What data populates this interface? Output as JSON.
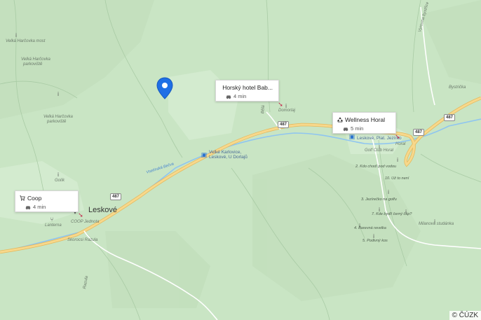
{
  "map": {
    "colors": {
      "land": "#c9e5c4",
      "road": "#f7d88c",
      "road_casing": "#e5b85a",
      "water": "#8fc5f0",
      "pin": "#1f6fe5"
    },
    "attribution": "© ČÚZK",
    "place_labels": {
      "town": "Leskové",
      "velka_harcovka_most": "Velká Harčovka most",
      "velka_harcovka_parkoviste_1": "Velká Harčovka",
      "velka_harcovka_parkoviste_2": "parkoviště",
      "velka_harcovka_2": "Velká Harčovka",
      "velka_harcovka_3": "parkoviště",
      "golik": "Golík",
      "lanterna": "Lanterna",
      "coop_jednota": "COOP Jednota",
      "skorocsi": "Skorocsi Razula",
      "razula": "Razula",
      "domorlaj": "Domorlaj",
      "horal": "Horal",
      "golf_club_horal": "Golf Club Horal",
      "milanova_studanka": "Milanova studánka",
      "bystricka": "Bystrička",
      "vyrovna": "Vyrovna bystřice",
      "bel": "Bělá"
    },
    "trail_labels": {
      "t1": "Leskové, Plat. Jezírko",
      "t2": "2. Kdo chodí pod vodou",
      "t3": "10. Už to není",
      "t4": "3. Jezírečko na golfu",
      "t5": "7. Kde bydlí černý čáp?",
      "t6": "4. Barevná revelka",
      "t7": "5. Podivný kos"
    },
    "stream_labels": {
      "s1": "Vsetínská Bečva"
    },
    "bus_stop_labels": {
      "b1": "Velké Karlovice,",
      "b2": "Leskové, U Dorlajů"
    },
    "road_shields": {
      "r1": "487",
      "r2": "487",
      "r3": "487",
      "r4": "487"
    },
    "cards": {
      "hotel": {
        "icon": "restaurant-icon",
        "title": "Horský hotel Bab...",
        "time": "4 min"
      },
      "wellness": {
        "icon": "hotel-icon",
        "title": "Wellness Horal",
        "time": "5 min"
      },
      "coop": {
        "icon": "shopping-cart-icon",
        "title": "Coop",
        "time": "4 min"
      }
    },
    "pin_icon": "location-pin-icon",
    "car_icon": "car-icon"
  }
}
